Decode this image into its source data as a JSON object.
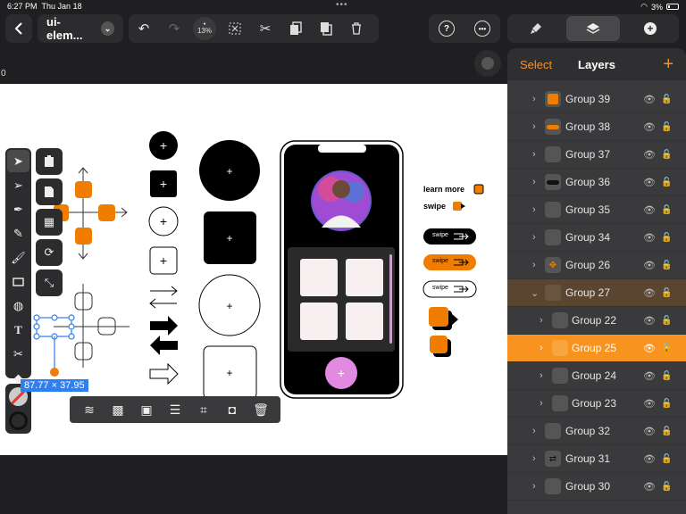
{
  "status": {
    "time": "6:27 PM",
    "date": "Thu Jan 18",
    "battery": "3%"
  },
  "toolbar": {
    "doc_name": "ui-elem...",
    "zoom": "13%"
  },
  "ruler": {
    "origin_label": "0"
  },
  "selection": {
    "size": "87.77 × 37.95"
  },
  "canvas": {
    "learn_more": "learn more",
    "swipe": "swipe",
    "pill_labels": [
      "swipe",
      "swipe",
      "swipe"
    ]
  },
  "panel": {
    "select_label": "Select",
    "title": "Layers",
    "add_label": "+",
    "layers": [
      {
        "name": "Group 39"
      },
      {
        "name": "Group 38"
      },
      {
        "name": "Group 37"
      },
      {
        "name": "Group 36"
      },
      {
        "name": "Group 35"
      },
      {
        "name": "Group 34"
      },
      {
        "name": "Group 26"
      },
      {
        "name": "Group 27"
      },
      {
        "name": "Group 22"
      },
      {
        "name": "Group 25"
      },
      {
        "name": "Group 24"
      },
      {
        "name": "Group 23"
      },
      {
        "name": "Group 32"
      },
      {
        "name": "Group 31"
      },
      {
        "name": "Group 30"
      }
    ]
  },
  "colors": {
    "accent": "#f7931e",
    "selection": "#2f7ff0"
  }
}
